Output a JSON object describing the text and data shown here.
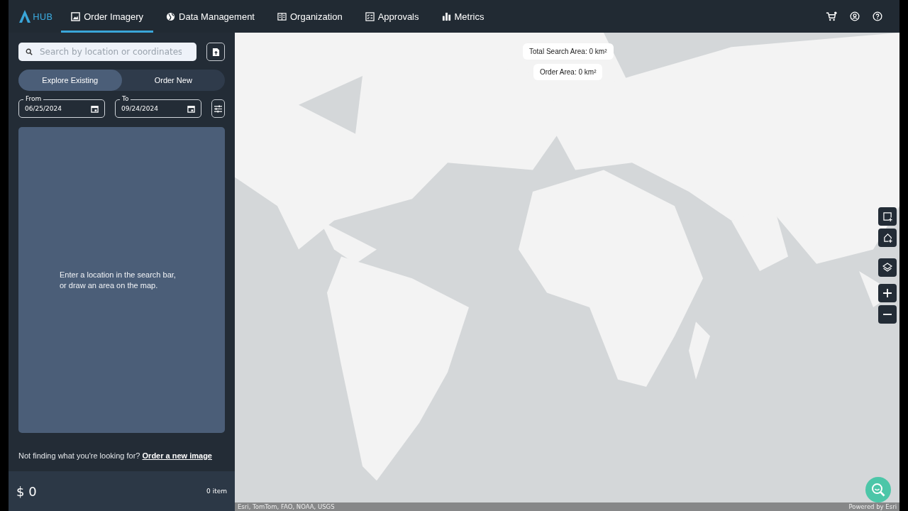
{
  "brand": "HUB",
  "nav": [
    {
      "label": "Order Imagery",
      "selected": true
    },
    {
      "label": "Data Management",
      "selected": false
    },
    {
      "label": "Organization",
      "selected": false
    },
    {
      "label": "Approvals",
      "selected": false
    },
    {
      "label": "Metrics",
      "selected": false
    }
  ],
  "header_icons": [
    {
      "kind": "cart"
    },
    {
      "kind": "account"
    },
    {
      "kind": "help"
    }
  ],
  "search": {
    "placeholder": "Search by location or coordinates"
  },
  "mode_toggle": [
    {
      "label": "Explore Existing",
      "selected": true
    },
    {
      "label": "Order New",
      "selected": false
    }
  ],
  "dates": [
    {
      "label": "From",
      "value": "06/25/2024"
    },
    {
      "label": "To",
      "value": "09/24/2024"
    }
  ],
  "results": {
    "message": "Enter a location in the search bar, or draw an area on the map."
  },
  "footer": {
    "text": "Not finding what you're looking for?",
    "link": "Order a new image"
  },
  "cart_summary": {
    "total": "$ 0",
    "items": "0 item"
  },
  "map": {
    "kind": "picture",
    "chips": [
      "Total Search Area: 0 km²",
      "Order Area: 0 km²"
    ],
    "tools": [
      {
        "kind": "rectangle"
      },
      {
        "kind": "polygon"
      },
      {
        "kind": "layers"
      },
      {
        "kind": "zoom-in"
      },
      {
        "kind": "zoom-out"
      }
    ],
    "attribution": "Esri, TomTom, FAO, NOAA, USGS",
    "powered_by": "Powered by Esri"
  }
}
